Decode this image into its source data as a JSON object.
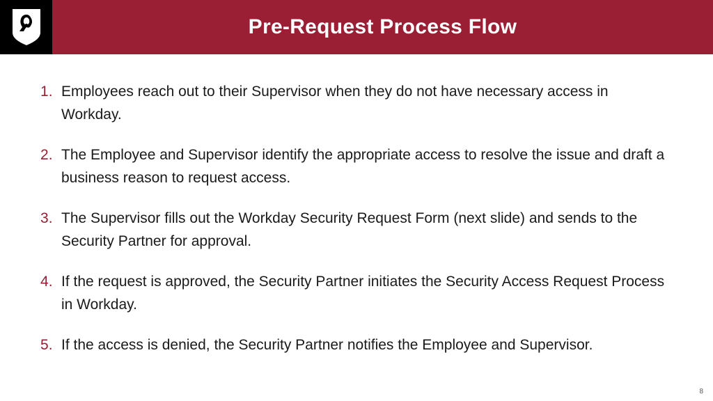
{
  "header": {
    "title": "Pre-Request Process Flow",
    "logo_name": "shield-logo"
  },
  "steps": [
    "Employees reach out to their Supervisor when they do not have necessary access in Workday.",
    "The Employee and Supervisor identify the appropriate access to resolve the issue and draft a business reason to request access.",
    "The Supervisor fills out the Workday Security Request Form (next slide) and sends to the Security Partner for approval.",
    "If the request is approved, the Security Partner initiates the Security Access Request Process in Workday.",
    "If the access is denied, the Security Partner notifies the Employee and Supervisor."
  ],
  "page_number": "8",
  "colors": {
    "brand_red": "#9a1e34",
    "logo_bg": "#000000"
  }
}
